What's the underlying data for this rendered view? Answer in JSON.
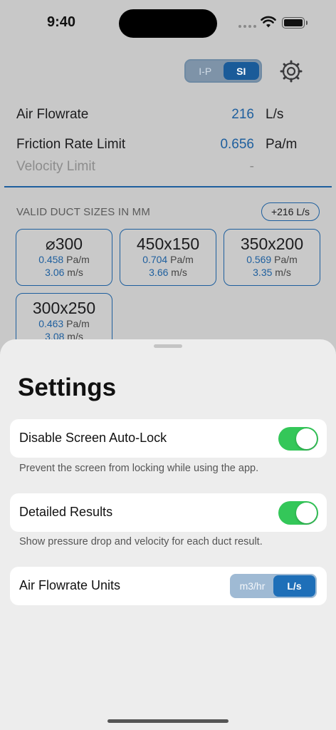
{
  "status_bar": {
    "time": "9:40"
  },
  "header": {
    "unit_system": {
      "options": [
        "I-P",
        "SI"
      ],
      "selected": "SI"
    },
    "settings_icon": "gear-icon"
  },
  "inputs": {
    "air_flowrate": {
      "label": "Air Flowrate",
      "value": "216",
      "unit": "L/s"
    },
    "friction_rate_limit": {
      "label": "Friction Rate Limit",
      "value": "0.656",
      "unit": "Pa/m"
    },
    "velocity_limit": {
      "label": "Velocity Limit",
      "value": "-"
    }
  },
  "results": {
    "heading": "VALID DUCT SIZES IN MM",
    "flow_badge": "+216 L/s",
    "ducts": [
      {
        "size": "⌀300",
        "friction": "0.458",
        "friction_unit": "Pa/m",
        "velocity": "3.06",
        "velocity_unit": "m/s"
      },
      {
        "size": "450x150",
        "friction": "0.704",
        "friction_unit": "Pa/m",
        "velocity": "3.66",
        "velocity_unit": "m/s"
      },
      {
        "size": "350x200",
        "friction": "0.569",
        "friction_unit": "Pa/m",
        "velocity": "3.35",
        "velocity_unit": "m/s"
      },
      {
        "size": "300x250",
        "friction": "0.463",
        "friction_unit": "Pa/m",
        "velocity": "3.08",
        "velocity_unit": "m/s"
      }
    ]
  },
  "settings": {
    "title": "Settings",
    "auto_lock": {
      "label": "Disable Screen Auto-Lock",
      "footer": "Prevent the screen from locking while using the app.",
      "enabled": true
    },
    "detailed_results": {
      "label": "Detailed Results",
      "footer": "Show pressure drop and velocity for each duct result.",
      "enabled": true
    },
    "flow_units": {
      "label": "Air Flowrate Units",
      "options": [
        "m3/hr",
        "L/s"
      ],
      "selected": "L/s"
    }
  },
  "colors": {
    "accent": "#1e5f9e",
    "switch_on": "#34c759",
    "segment_active": "#1e6fb8"
  }
}
